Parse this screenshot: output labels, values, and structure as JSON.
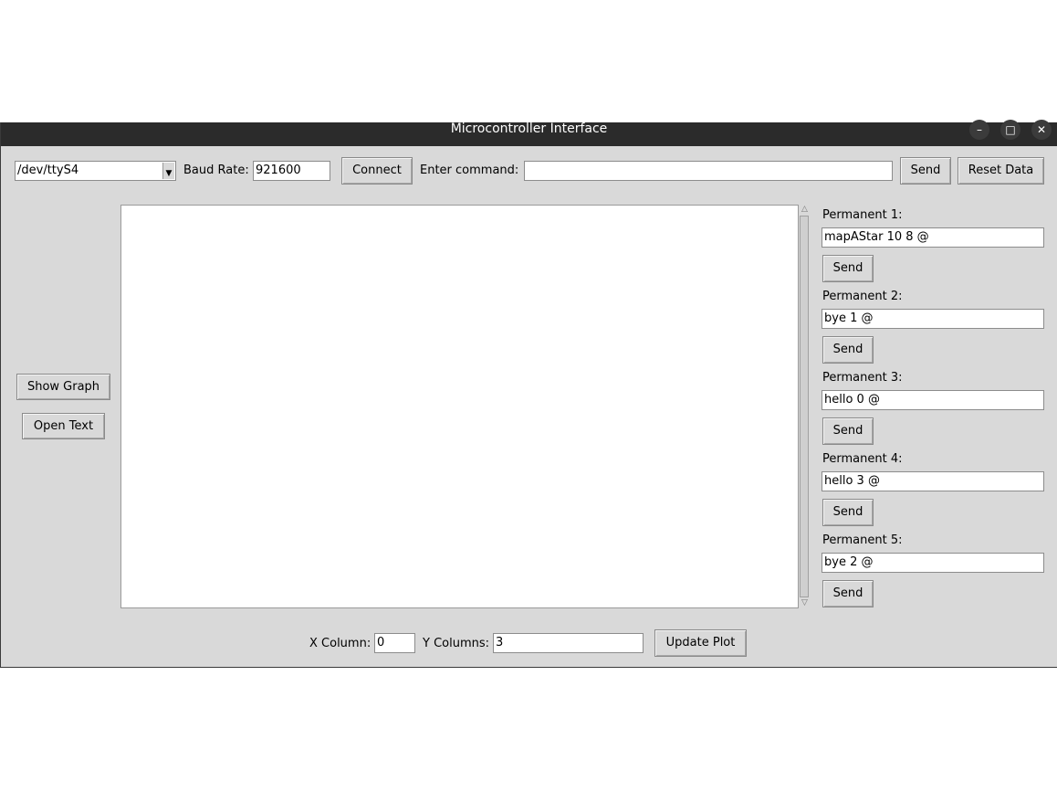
{
  "window": {
    "title": "Microcontroller Interface"
  },
  "toolbar": {
    "port_value": "/dev/ttyS4",
    "baud_label": "Baud Rate:",
    "baud_value": "921600",
    "connect_label": "Connect",
    "command_label": "Enter command:",
    "command_value": "",
    "send_label": "Send",
    "reset_label": "Reset Data"
  },
  "left_panel": {
    "show_graph_label": "Show Graph",
    "open_text_label": "Open Text"
  },
  "permanent": [
    {
      "label": "Permanent 1:",
      "value": "mapAStar 10 8 @",
      "send_label": "Send"
    },
    {
      "label": "Permanent 2:",
      "value": "bye 1 @",
      "send_label": "Send"
    },
    {
      "label": "Permanent 3:",
      "value": "hello 0 @",
      "send_label": "Send"
    },
    {
      "label": "Permanent 4:",
      "value": "hello 3 @",
      "send_label": "Send"
    },
    {
      "label": "Permanent 5:",
      "value": "bye 2 @",
      "send_label": "Send"
    }
  ],
  "plot_controls": {
    "x_label": "X Column:",
    "x_value": "0",
    "y_label": "Y Columns:",
    "y_value": "3",
    "update_label": "Update Plot"
  },
  "icons": {
    "minimize": "minimize-icon",
    "maximize": "maximize-icon",
    "close": "close-icon",
    "dropdown": "chevron-down-icon"
  }
}
